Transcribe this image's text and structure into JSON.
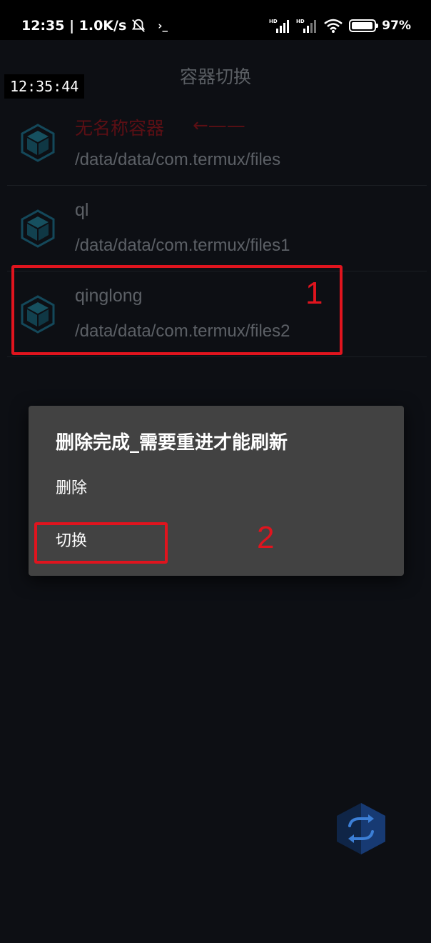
{
  "status_bar": {
    "time": "12:35 | 1.0K/s",
    "terminal_glyph": "›_",
    "battery": "97%"
  },
  "header": {
    "title": "容器切换",
    "clock_overlay": "12:35:44"
  },
  "containers": [
    {
      "name": "无名称容器",
      "arrow": "←——",
      "path": "/data/data/com.termux/files"
    },
    {
      "name": "ql",
      "path": "/data/data/com.termux/files1"
    },
    {
      "name": "qinglong",
      "path": "/data/data/com.termux/files2"
    }
  ],
  "annotations": {
    "label_1": "1",
    "label_2": "2",
    "color": "#e0141e"
  },
  "dialog": {
    "title": "删除完成_需要重进才能刷新",
    "options": [
      "删除",
      "切换"
    ]
  },
  "colors": {
    "background": "#0d0f14",
    "dialog": "#424242",
    "icon_teal": "#1a5566",
    "fab_blue": "#1b3a6e"
  },
  "icons": {
    "container": "cube-icon",
    "fab": "switch-arrows-icon"
  }
}
